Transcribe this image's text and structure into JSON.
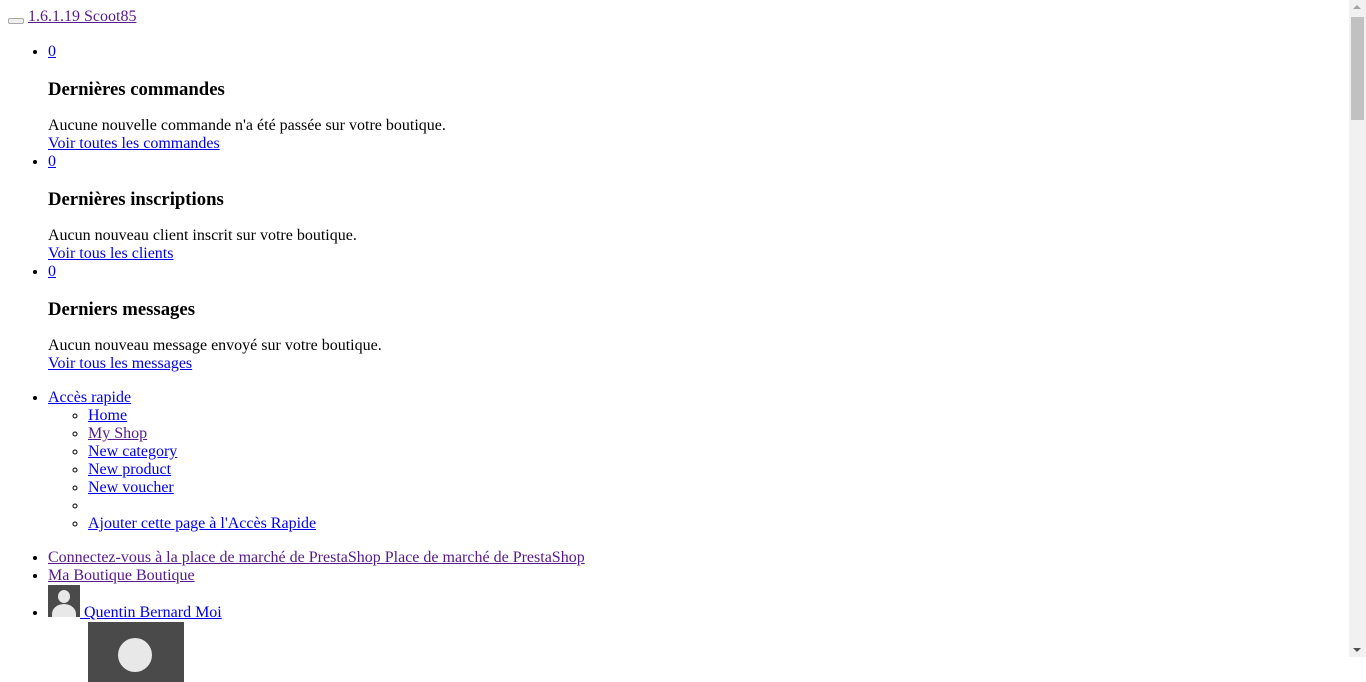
{
  "header": {
    "shop_link": "1.6.1.19 Scoot85"
  },
  "notifications": [
    {
      "count": "0",
      "title": "Dernières commandes",
      "message": "Aucune nouvelle commande n'a été passée sur votre boutique.",
      "link": "Voir toutes les commandes"
    },
    {
      "count": "0",
      "title": "Dernières inscriptions",
      "message": "Aucun nouveau client inscrit sur votre boutique.",
      "link": "Voir tous les clients"
    },
    {
      "count": "0",
      "title": "Derniers messages",
      "message": "Aucun nouveau message envoyé sur votre boutique.",
      "link": "Voir tous les messages"
    }
  ],
  "quick_access": {
    "label": "Accès rapide",
    "items": [
      "Home",
      "My Shop",
      "New category",
      "New product",
      "New voucher",
      "",
      "Ajouter cette page à l'Accès Rapide"
    ]
  },
  "menu": {
    "marketplace": "Connectez-vous à la place de marché de PrestaShop Place de marché de PrestaShop",
    "shop": "Ma Boutique Boutique",
    "employee": "Quentin Bernard Moi"
  },
  "icons": {
    "menu_toggle": "menu-toggle-icon",
    "avatar": "user-avatar-icon"
  },
  "colors": {
    "link": "#0000ee",
    "link_visited": "#551a8b",
    "avatar_bg": "#4a4a4a"
  }
}
